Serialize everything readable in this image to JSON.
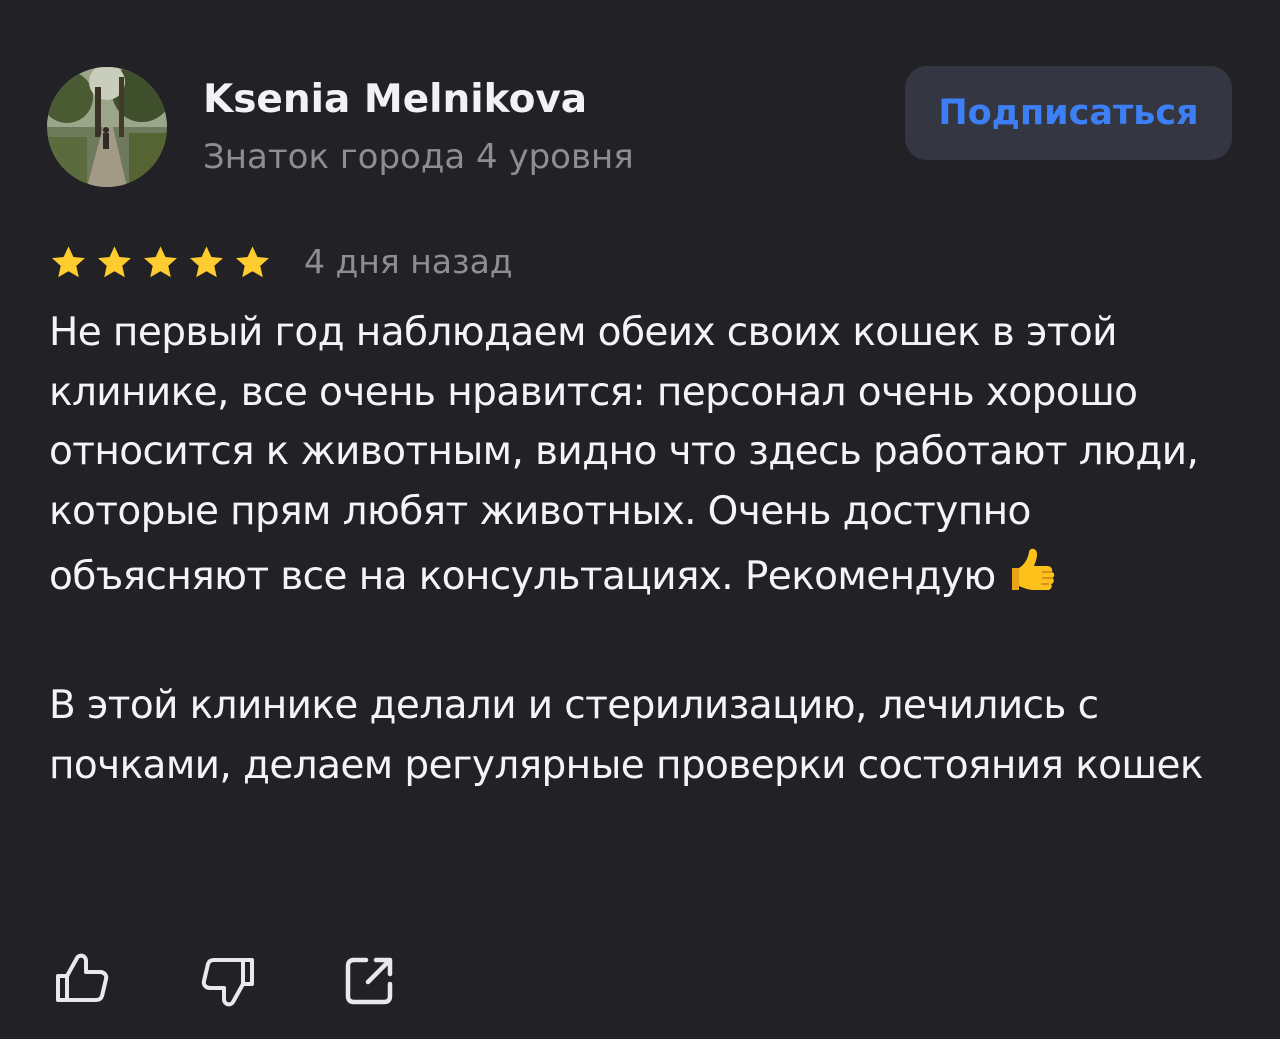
{
  "author": {
    "name": "Ksenia Melnikova",
    "level": "Знаток города 4 уровня",
    "avatar_icon": "park-path-photo"
  },
  "subscribe_label": "Подписаться",
  "review": {
    "rating": 5,
    "rating_max": 5,
    "date": "4 дня назад",
    "paragraph_1": "Не первый год наблюдаем обеих своих кошек в этой клинике, все очень нравится: персонал очень хорошо относится к животным, видно что здесь работают люди, которые прям любят животных. Очень доступно объясняют все на консультациях. Рекомендую",
    "paragraph_1_emoji": "thumbs-up-emoji",
    "paragraph_2": "В этой клинике делали и стерилизацию, лечились с почками, делаем регулярные проверки состояния кошек"
  },
  "actions": [
    {
      "icon": "thumbs-up-icon"
    },
    {
      "icon": "thumbs-down-icon"
    },
    {
      "icon": "share-icon"
    }
  ],
  "colors": {
    "background": "#222226",
    "accent": "#3d7ff5",
    "button_bg": "#343741",
    "secondary_text": "#8d8d93",
    "star": "#fecc2f"
  }
}
